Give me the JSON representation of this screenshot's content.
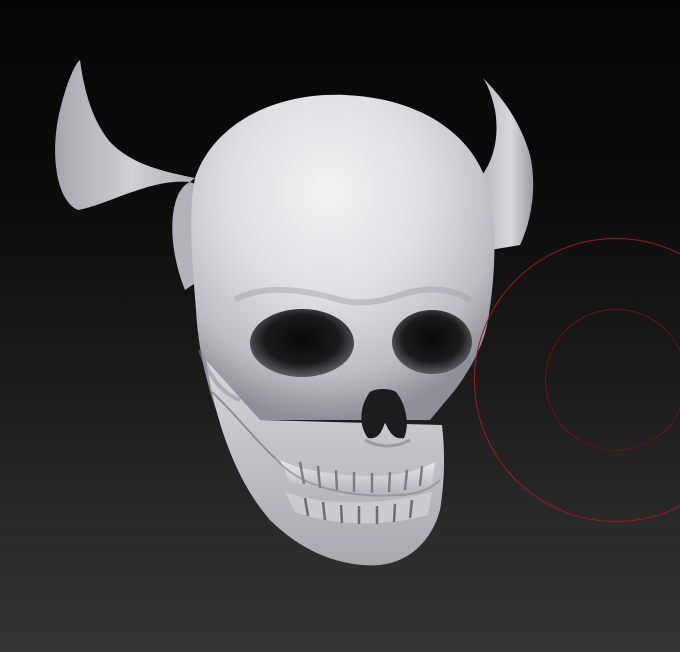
{
  "viewport": {
    "background_top": "#050505",
    "background_bottom": "#343434"
  },
  "model": {
    "subject": "horned-skull-sculpt",
    "material_color": "#e2e2e6",
    "shadow_color": "#8e8e96"
  },
  "brush_cursor": {
    "outer_ring_color": "#a01a1a",
    "inner_ring_color": "#6a1414",
    "focal_ratio": 0.5
  }
}
